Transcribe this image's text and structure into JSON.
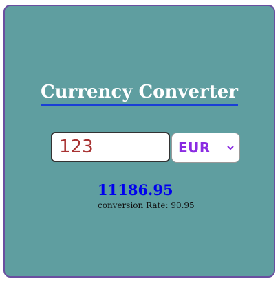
{
  "converter": {
    "title": "Currency Converter",
    "amount_value": "123",
    "currency_selected": "EUR",
    "result": "11186.95",
    "rate_label": "conversion Rate:",
    "rate_value": "90.95"
  },
  "icons": {
    "select_arrow": "chevron-down-icon"
  },
  "colors": {
    "card_background": "#5f9ea0",
    "card_border": "#6a4fa0",
    "title_underline": "#1a3fd6",
    "amount_text": "#a83232",
    "currency_text": "#8a2be2",
    "result_text": "#0000ee"
  }
}
